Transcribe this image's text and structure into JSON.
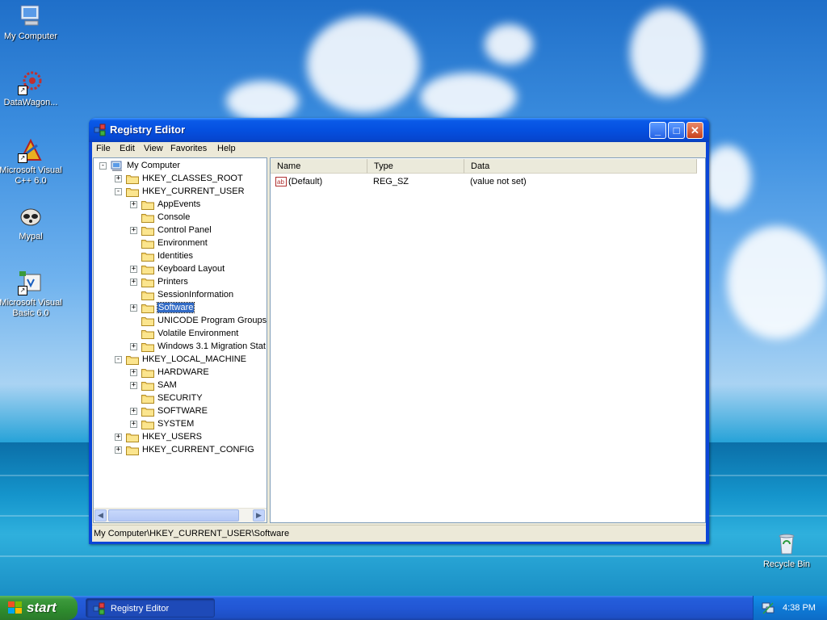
{
  "desktop": {
    "icons": [
      {
        "label": "My Computer",
        "icon": "my-computer-icon"
      },
      {
        "label": "DataWagon...",
        "icon": "datawagon-icon"
      },
      {
        "label": "Microsoft Visual C++ 6.0",
        "icon": "visual-cpp-icon"
      },
      {
        "label": "Mypal",
        "icon": "mypal-icon"
      },
      {
        "label": "Microsoft Visual Basic 6.0",
        "icon": "visual-basic-icon"
      },
      {
        "label": "Recycle Bin",
        "icon": "recycle-bin-icon"
      }
    ]
  },
  "window": {
    "title": "Registry Editor",
    "menu": [
      "File",
      "Edit",
      "View",
      "Favorites",
      "Help"
    ],
    "tree": [
      {
        "label": "My Computer",
        "toggle": "-"
      },
      {
        "label": "HKEY_CLASSES_ROOT",
        "toggle": "+"
      },
      {
        "label": "HKEY_CURRENT_USER",
        "toggle": "-"
      },
      {
        "label": "AppEvents",
        "toggle": "+"
      },
      {
        "label": "Console",
        "toggle": ""
      },
      {
        "label": "Control Panel",
        "toggle": "+"
      },
      {
        "label": "Environment",
        "toggle": ""
      },
      {
        "label": "Identities",
        "toggle": ""
      },
      {
        "label": "Keyboard Layout",
        "toggle": "+"
      },
      {
        "label": "Printers",
        "toggle": "+"
      },
      {
        "label": "SessionInformation",
        "toggle": ""
      },
      {
        "label": "Software",
        "toggle": "+",
        "selected": true
      },
      {
        "label": "UNICODE Program Groups",
        "toggle": ""
      },
      {
        "label": "Volatile Environment",
        "toggle": ""
      },
      {
        "label": "Windows 3.1 Migration Stat",
        "toggle": "+"
      },
      {
        "label": "HKEY_LOCAL_MACHINE",
        "toggle": "-"
      },
      {
        "label": "HARDWARE",
        "toggle": "+"
      },
      {
        "label": "SAM",
        "toggle": "+"
      },
      {
        "label": "SECURITY",
        "toggle": ""
      },
      {
        "label": "SOFTWARE",
        "toggle": "+"
      },
      {
        "label": "SYSTEM",
        "toggle": "+"
      },
      {
        "label": "HKEY_USERS",
        "toggle": "+"
      },
      {
        "label": "HKEY_CURRENT_CONFIG",
        "toggle": "+"
      }
    ],
    "columns": [
      "Name",
      "Type",
      "Data"
    ],
    "values": [
      {
        "name": "(Default)",
        "type": "REG_SZ",
        "data": "(value not set)"
      }
    ],
    "status": "My Computer\\HKEY_CURRENT_USER\\Software"
  },
  "taskbar": {
    "start_label": "start",
    "task_label": "Registry Editor",
    "clock": "4:38 PM"
  }
}
